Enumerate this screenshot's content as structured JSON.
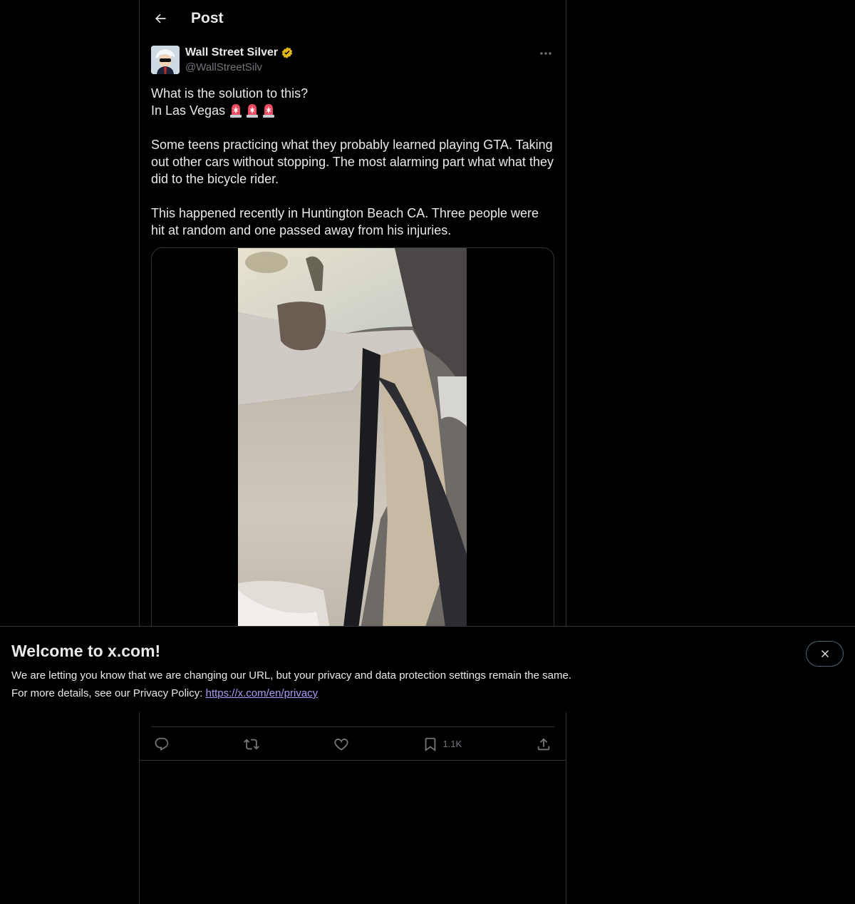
{
  "header": {
    "title": "Post"
  },
  "post": {
    "author_name": "Wall Street Silver",
    "author_handle": "@WallStreetSilv",
    "text_line1": "What is the solution to this?",
    "text_line2": "In Las Vegas",
    "paragraph2": "Some teens practicing what they probably learned playing GTA. Taking out other cars without stopping. The most alarming part what what they did to the bicycle rider.",
    "paragraph3": "This happened recently in Huntington Beach CA. Three people were hit at random and one passed away from his injuries.",
    "bookmark_count": "1.1K"
  },
  "banner": {
    "title": "Welcome to x.com!",
    "line1": "We are letting you know that we are changing our URL, but your privacy and data protection settings remain the same.",
    "line2_prefix": "For more details, see our Privacy Policy:",
    "privacy_link": "https://x.com/en/privacy"
  },
  "colors": {
    "background": "#000000",
    "text_primary": "#e7e9ea",
    "text_secondary": "#71767b",
    "border": "#2f3336",
    "link": "#a99cf4",
    "verified_gold": "#e2b719"
  },
  "icons": {
    "back": "arrow-left-icon",
    "verified": "verified-gold-badge-icon",
    "more": "more-horizontal-icon",
    "siren": "rotating-light-emoji",
    "reply": "reply-icon",
    "repost": "repost-icon",
    "like": "heart-icon",
    "bookmark": "bookmark-icon",
    "share": "share-icon",
    "close": "close-icon"
  }
}
